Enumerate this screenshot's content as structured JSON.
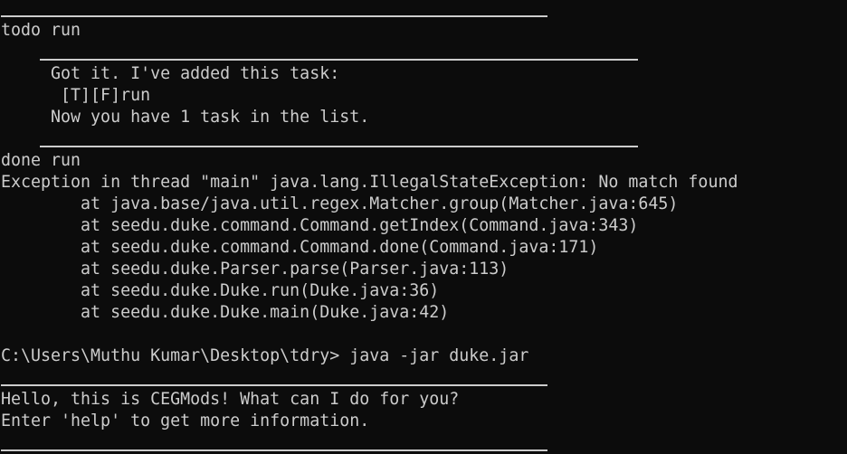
{
  "theme": {
    "background": "#0c0c0c",
    "foreground": "#cccccc"
  },
  "lines": {
    "l0": "todo run",
    "l1": "     Got it. I've added this task:",
    "l2": "      [T][F]run",
    "l3": "     Now you have 1 task in the list.",
    "l4": "done run",
    "l5": "Exception in thread \"main\" java.lang.IllegalStateException: No match found",
    "l6": "        at java.base/java.util.regex.Matcher.group(Matcher.java:645)",
    "l7": "        at seedu.duke.command.Command.getIndex(Command.java:343)",
    "l8": "        at seedu.duke.command.Command.done(Command.java:171)",
    "l9": "        at seedu.duke.Parser.parse(Parser.java:113)",
    "l10": "        at seedu.duke.Duke.run(Duke.java:36)",
    "l11": "        at seedu.duke.Duke.main(Duke.java:42)",
    "l12": "C:\\Users\\Muthu Kumar\\Desktop\\tdry> java -jar duke.jar",
    "l13": "Hello, this is CEGMods! What can I do for you?",
    "l14": "Enter 'help' to get more information."
  }
}
